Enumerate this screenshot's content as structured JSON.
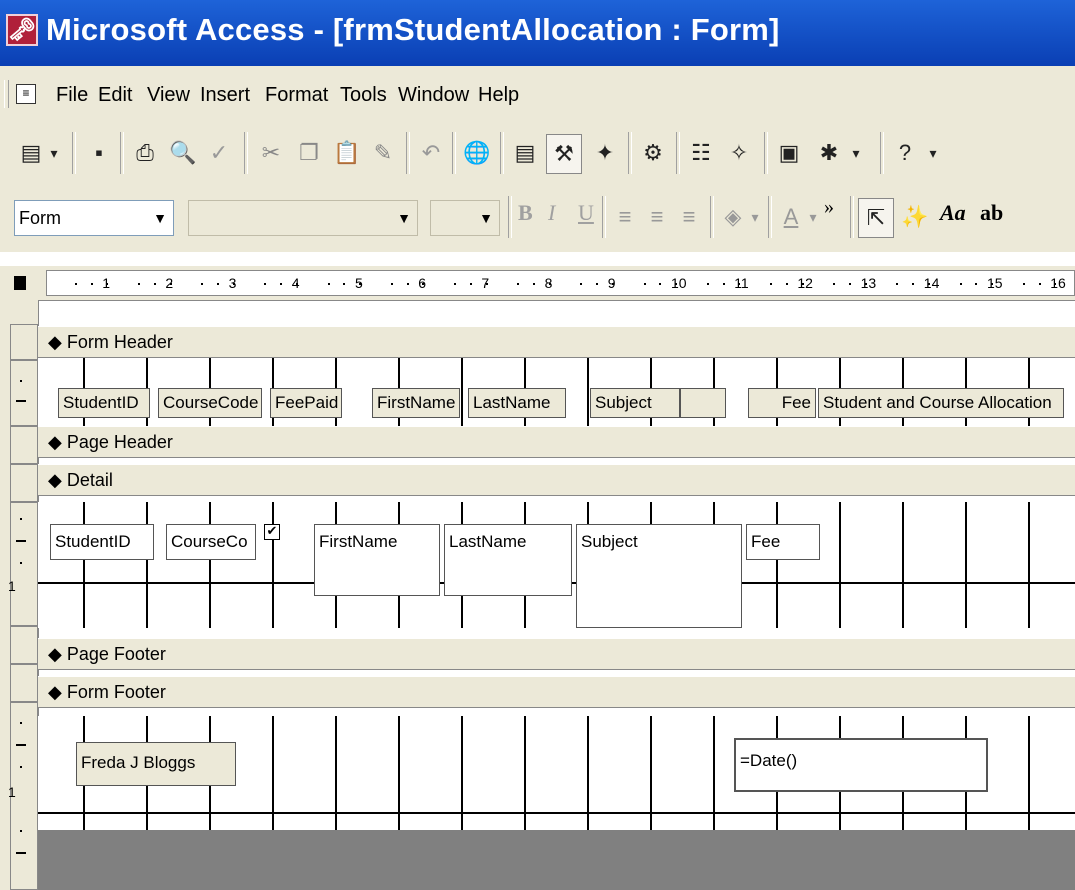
{
  "window": {
    "title": "Microsoft Access - [frmStudentAllocation : Form]"
  },
  "menu": {
    "items": [
      "File",
      "Edit",
      "View",
      "Insert",
      "Format",
      "Tools",
      "Window",
      "Help"
    ]
  },
  "toolbar2": {
    "object_combo": "Form",
    "font_combo": "",
    "size_combo": "",
    "bold": "B",
    "italic": "I",
    "underline": "U",
    "chevron": "»",
    "label_tool": "Aa",
    "textbox_tool": "ab"
  },
  "ruler": {
    "numbers": [
      "1",
      "2",
      "3",
      "4",
      "5",
      "6",
      "7",
      "8",
      "9",
      "10",
      "11",
      "12",
      "13",
      "14",
      "15",
      "16"
    ]
  },
  "sections": {
    "form_header": "Form Header",
    "page_header": "Page Header",
    "detail": "Detail",
    "page_footer": "Page Footer",
    "form_footer": "Form Footer"
  },
  "form_header_controls": [
    "StudentID",
    "CourseCode",
    "FeePaid",
    "FirstName",
    "LastName",
    "Subject",
    "",
    "Fee",
    "Student and Course Allocation"
  ],
  "detail_controls": {
    "student_id": "StudentID",
    "course_code": "CourseCo",
    "checkbox_checked": true,
    "first_name": "FirstName",
    "last_name": "LastName",
    "subject": "Subject",
    "fee": "Fee"
  },
  "form_footer_controls": {
    "name_label": "Freda J Bloggs",
    "date_box": "=Date()"
  },
  "vertical_ruler": {
    "one_mark": "1"
  }
}
